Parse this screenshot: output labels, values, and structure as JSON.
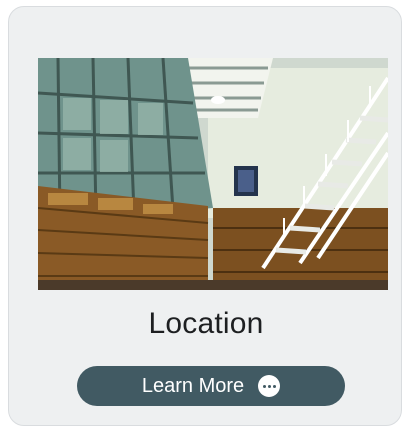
{
  "card": {
    "title": "Location",
    "image_alt": "Library interior with tall windows, bookshelves and a white staircase",
    "button": {
      "label": "Learn More",
      "icon": "more-horizontal-icon"
    }
  },
  "colors": {
    "card_background": "#eef0f1",
    "button_background": "#415a63",
    "button_text": "#ffffff",
    "title_text": "#1d1f21"
  }
}
